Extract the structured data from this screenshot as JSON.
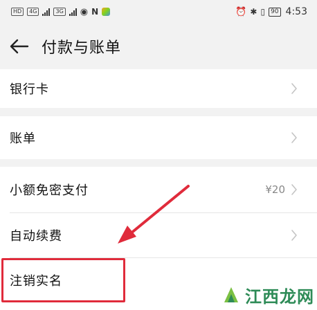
{
  "status_bar": {
    "left_tags": [
      "HD",
      "4G",
      "3G"
    ],
    "time": "4:53",
    "battery": "90"
  },
  "header": {
    "title": "付款与账单"
  },
  "menu": {
    "bank_card": "银行卡",
    "bill": "账单",
    "small_pay": "小额免密支付",
    "small_pay_value": "¥20",
    "auto_renew": "自动续费",
    "cancel_realname": "注销实名"
  },
  "watermark": {
    "text": "江西龙网"
  },
  "colors": {
    "highlight": "#e02b3b",
    "watermark": "#2e8b57"
  }
}
